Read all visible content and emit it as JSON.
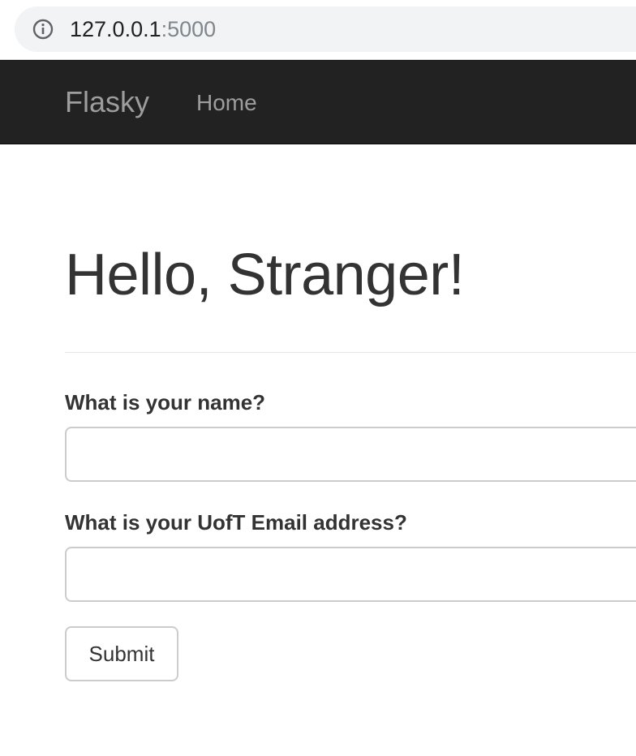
{
  "browser": {
    "url_host": "127.0.0.1",
    "url_port": ":5000",
    "info_icon": "info-circle-icon"
  },
  "navbar": {
    "brand": "Flasky",
    "links": [
      {
        "label": "Home"
      }
    ]
  },
  "main": {
    "heading": "Hello, Stranger!",
    "form": {
      "name_label": "What is your name?",
      "name_value": "",
      "email_label": "What is your UofT Email address?",
      "email_value": "",
      "submit_label": "Submit"
    }
  },
  "colors": {
    "navbar_bg": "#222222",
    "navbar_text": "#9d9d9d",
    "heading_text": "#333333",
    "input_border": "#cccccc"
  }
}
